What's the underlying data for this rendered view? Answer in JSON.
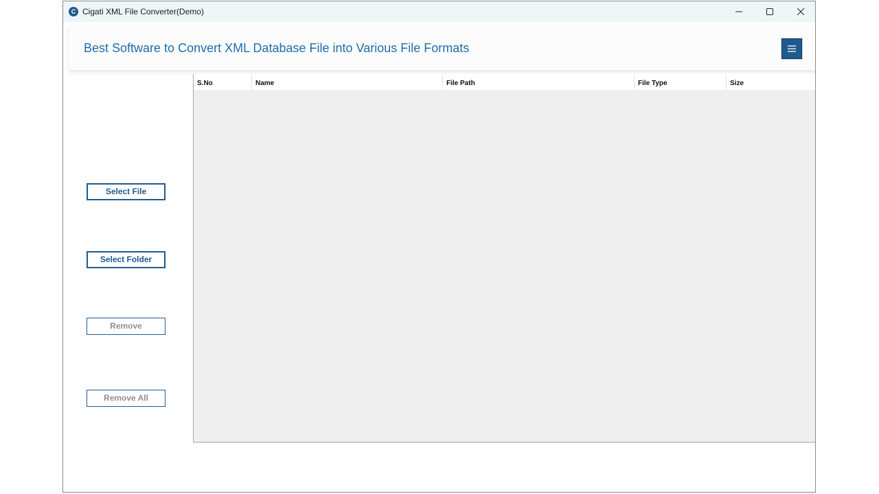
{
  "window": {
    "title": "Cigati XML File Converter(Demo)",
    "icon": "cigati-logo-icon",
    "controls": [
      "minimize-icon",
      "maximize-icon",
      "close-icon"
    ]
  },
  "header": {
    "title": "Best Software to Convert XML Database File into Various File Formats",
    "menu_icon": "hamburger-menu-icon"
  },
  "sidebar": {
    "buttons": [
      {
        "label": "Select File",
        "enabled": true
      },
      {
        "label": "Select Folder",
        "enabled": true
      },
      {
        "label": "Remove",
        "enabled": false
      },
      {
        "label": "Remove All",
        "enabled": false
      }
    ]
  },
  "table": {
    "columns": [
      "S.No",
      "Name",
      "File Path",
      "File Type",
      "Size"
    ],
    "rows": []
  },
  "colors": {
    "accent": "#1f5a8e",
    "title_text": "#1f6cad",
    "titlebar": "#eef6f9",
    "grid_background": "#efefef",
    "disabled_text": "#8f8f8f"
  }
}
